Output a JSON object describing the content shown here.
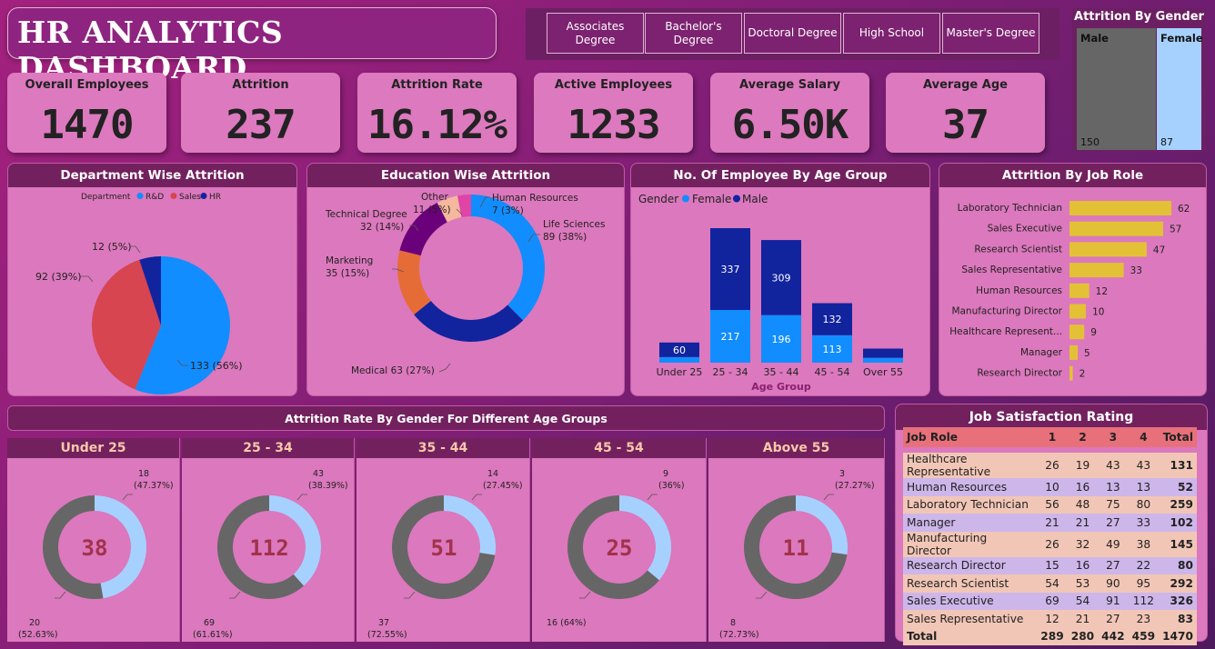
{
  "title": "HR ANALYTICS DASHBOARD",
  "education_filters": [
    "Associates Degree",
    "Bachelor's Degree",
    "Doctoral Degree",
    "High School",
    "Master's Degree"
  ],
  "kpis": [
    {
      "label": "Overall Employees",
      "value": "1470"
    },
    {
      "label": "Attrition",
      "value": "237"
    },
    {
      "label": "Attrition Rate",
      "value": "16.12%"
    },
    {
      "label": "Active Employees",
      "value": "1233"
    },
    {
      "label": "Average Salary",
      "value": "6.50K"
    },
    {
      "label": "Average Age",
      "value": "37"
    }
  ],
  "attrition_by_gender": {
    "title": "Attrition By Gender",
    "male_label": "Male",
    "female_label": "Female",
    "male_value": "150",
    "female_value": "87",
    "male": 150,
    "female": 87
  },
  "chart_data": [
    {
      "type": "pie",
      "title": "Department Wise Attrition",
      "legend_title": "Department",
      "categories": [
        "R&D",
        "Sales",
        "HR"
      ],
      "values": [
        133,
        92,
        12
      ],
      "labels": [
        "133 (56%)",
        "92 (39%)",
        "12 (5%)"
      ],
      "colors": [
        "#118dff",
        "#d64550",
        "#12239e"
      ]
    },
    {
      "type": "pie",
      "title": "Education Wise Attrition",
      "categories": [
        "Life Sciences",
        "Medical",
        "Marketing",
        "Technical Degree",
        "Other",
        "Human Resources"
      ],
      "values": [
        89,
        63,
        35,
        32,
        11,
        7
      ],
      "labels": [
        [
          "Life Sciences",
          "89 (38%)"
        ],
        [
          "Medical 63 (27%)"
        ],
        [
          "Marketing",
          "35 (15%)"
        ],
        [
          "Technical Degree",
          "32 (14%)"
        ],
        [
          "Other",
          "11 (5%)"
        ],
        [
          "Human Resources",
          "7 (3%)"
        ]
      ],
      "colors": [
        "#118dff",
        "#12239e",
        "#e66c37",
        "#6b007b",
        "#f5b79e",
        "#e044a7"
      ]
    },
    {
      "type": "bar",
      "title": "No. Of Employee By Age Group",
      "legend_title": "Gender",
      "categories": [
        "Under 25",
        "25 - 34",
        "35 - 44",
        "45 - 54",
        "Over 55"
      ],
      "xlabel": "Age Group",
      "series": [
        {
          "name": "Female",
          "values": [
            23,
            217,
            196,
            113,
            20
          ],
          "labels": [
            "",
            "217",
            "196",
            "113",
            ""
          ],
          "color": "#118dff"
        },
        {
          "name": "Male",
          "values": [
            60,
            337,
            309,
            132,
            38
          ],
          "labels": [
            "60",
            "337",
            "309",
            "132",
            ""
          ],
          "color": "#12239e"
        }
      ]
    },
    {
      "type": "bar",
      "title": "Attrition By Job Role",
      "categories": [
        "Laboratory Technician",
        "Sales Executive",
        "Research Scientist",
        "Sales Representative",
        "Human Resources",
        "Manufacturing Director",
        "Healthcare Represent...",
        "Manager",
        "Research Director"
      ],
      "values": [
        62,
        57,
        47,
        33,
        12,
        10,
        9,
        5,
        2
      ],
      "color": "#e3c136"
    },
    {
      "type": "pie",
      "title": "Attrition Rate By Gender For Different Age Groups",
      "groups": [
        {
          "name": "Under 25",
          "total": "38",
          "male": 20,
          "female": 18,
          "male_label": [
            "20",
            "(52.63%)"
          ],
          "female_label": [
            "18",
            "(47.37%)"
          ]
        },
        {
          "name": "25 - 34",
          "total": "112",
          "male": 69,
          "female": 43,
          "male_label": [
            "69",
            "(61.61%)"
          ],
          "female_label": [
            "43",
            "(38.39%)"
          ]
        },
        {
          "name": "35 - 44",
          "total": "51",
          "male": 37,
          "female": 14,
          "male_label": [
            "37",
            "(72.55%)"
          ],
          "female_label": [
            "14",
            "(27.45%)"
          ]
        },
        {
          "name": "45 - 54",
          "total": "25",
          "male": 16,
          "female": 9,
          "male_label": [
            "16 (64%)"
          ],
          "female_label": [
            "9",
            "(36%)"
          ]
        },
        {
          "name": "Above 55",
          "total": "11",
          "male": 8,
          "female": 3,
          "male_label": [
            "8",
            "(72.73%)"
          ],
          "female_label": [
            "3",
            "(27.27%)"
          ]
        }
      ],
      "colors": {
        "male": "#666666",
        "female": "#a6d1ff"
      }
    },
    {
      "type": "table",
      "title": "Job Satisfaction Rating",
      "columns": [
        "Job Role",
        "1",
        "2",
        "3",
        "4",
        "Total"
      ],
      "rows": [
        [
          "Healthcare Representative",
          26,
          19,
          43,
          43,
          131
        ],
        [
          "Human Resources",
          10,
          16,
          13,
          13,
          52
        ],
        [
          "Laboratory Technician",
          56,
          48,
          75,
          80,
          259
        ],
        [
          "Manager",
          21,
          21,
          27,
          33,
          102
        ],
        [
          "Manufacturing Director",
          26,
          32,
          49,
          38,
          145
        ],
        [
          "Research Director",
          15,
          16,
          27,
          22,
          80
        ],
        [
          "Research Scientist",
          54,
          53,
          90,
          95,
          292
        ],
        [
          "Sales Executive",
          69,
          54,
          91,
          112,
          326
        ],
        [
          "Sales Representative",
          12,
          21,
          27,
          23,
          83
        ]
      ],
      "total_row": [
        "Total",
        289,
        280,
        442,
        459,
        1470
      ]
    }
  ]
}
